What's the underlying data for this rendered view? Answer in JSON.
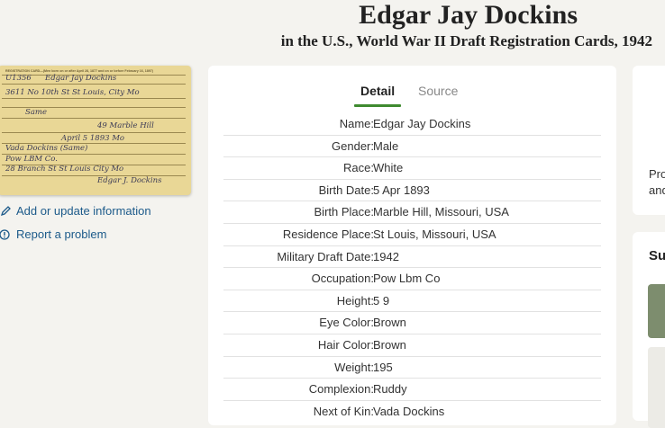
{
  "header": {
    "title": "Edgar Jay Dockins",
    "subtitle": "in the U.S., World War II Draft Registration Cards, 1942"
  },
  "sidebar": {
    "add_update_label": "Add or update information",
    "report_label": "Report a problem"
  },
  "tabs": [
    {
      "label": "Detail",
      "active": true
    },
    {
      "label": "Source",
      "active": false
    }
  ],
  "record": [
    {
      "label": "Name:",
      "value": "Edgar Jay Dockins"
    },
    {
      "label": "Gender:",
      "value": "Male"
    },
    {
      "label": "Race:",
      "value": "White"
    },
    {
      "label": "Birth Date:",
      "value": "5 Apr 1893"
    },
    {
      "label": "Birth Place:",
      "value": "Marble Hill, Missouri, USA"
    },
    {
      "label": "Residence Place:",
      "value": "St Louis, Missouri, USA"
    },
    {
      "label": "Military Draft Date:",
      "value": "1942"
    },
    {
      "label": "Occupation:",
      "value": "Pow Lbm Co"
    },
    {
      "label": "Height:",
      "value": "5 9"
    },
    {
      "label": "Eye Color:",
      "value": "Brown"
    },
    {
      "label": "Hair Color:",
      "value": "Brown"
    },
    {
      "label": "Weight:",
      "value": "195"
    },
    {
      "label": "Complexion:",
      "value": "Ruddy"
    },
    {
      "label": "Next of Kin:",
      "value": "Vada Dockins"
    }
  ],
  "right_cards": {
    "card1_text_line1": "Pro",
    "card1_text_line2": "and",
    "card2_header": "Su"
  },
  "document_card": {
    "header_text": "REGISTRATION CARD—(Men born on or after April 28, 1877 and on or before February 16, 1897)",
    "serial": "U1356",
    "name_line": "Edgar   Jay   Dockins",
    "address_line": "3611 No 10th St      St Louis, City   Mo",
    "mailing_line": "Same",
    "age_line": "49          Marble Hill",
    "birth_line": "April 5   1893     Mo",
    "kin_line": "Vada Dockins  (Same)",
    "employer_line": "Pow LBM Co.",
    "employer_addr_line": "28   Branch St   St Louis City   Mo",
    "signature": "Edgar J. Dockins"
  },
  "colors": {
    "accent_green": "#3e8a2f",
    "link_blue": "#1c5a8a",
    "background": "#f4f3ef"
  }
}
